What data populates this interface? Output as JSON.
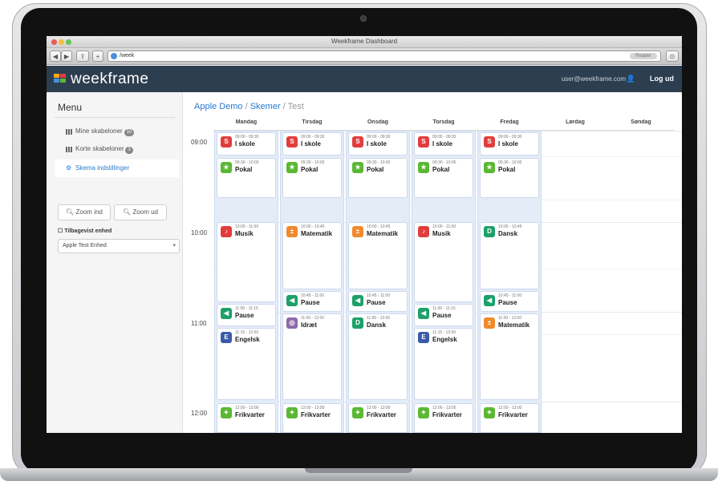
{
  "browser": {
    "window_title": "Weekframe Dashboard",
    "address": "/week",
    "reader_label": "Reader",
    "back_label": "◀",
    "forward_label": "▶",
    "share_label": "⇪",
    "add_label": "+"
  },
  "header": {
    "logo": "weekframe",
    "user_email": "user@weekframe.com",
    "logout": "Log ud",
    "colors": {
      "bar": "#2d3e50",
      "logo_a": "#f5a623",
      "logo_b": "#4a90d9"
    }
  },
  "sidebar": {
    "title": "Menu",
    "items": [
      {
        "label": "Mine skabeloner",
        "badge": "10",
        "icon": "grid-icon"
      },
      {
        "label": "Korte skabeloner",
        "badge": "3",
        "icon": "grid-icon"
      },
      {
        "label": "Skema indstillinger",
        "badge": "",
        "icon": "settings-icon"
      }
    ],
    "zoom_in": "Zoom ind",
    "zoom_out": "Zoom ud",
    "hide_label": "Tilbagevist enhed",
    "select_value": "Apple Test Enhed"
  },
  "breadcrumb": {
    "part1": "Apple Demo",
    "sep1": " / ",
    "part2": "Skemer",
    "sep2": " / ",
    "current": "Test"
  },
  "calendar": {
    "days": [
      "Mandag",
      "Tirsdag",
      "Onsdag",
      "Torsdag",
      "Fredag",
      "Lørdag",
      "Søndag"
    ],
    "hours": [
      "09:00",
      "10:00",
      "11:00",
      "12:00"
    ],
    "events": {
      "mon": [
        {
          "time": "09:00 - 09:30",
          "title": "I skole",
          "color": "#e23d3d",
          "icon": "S"
        },
        {
          "time": "09:30 - 10:00",
          "title": "Pokal",
          "color": "#5bb834",
          "icon": "★"
        },
        {
          "time": "10:00 - 11:00",
          "title": "Musik",
          "color": "#e23d3d",
          "icon": "♪"
        },
        {
          "time": "11:00 - 11:15",
          "title": "Pause",
          "color": "#1da06a",
          "icon": "◀"
        },
        {
          "time": "11:15 - 12:00",
          "title": "Engelsk",
          "color": "#3b5ba9",
          "icon": "E"
        },
        {
          "time": "12:00 - 13:00",
          "title": "Frikvarter",
          "color": "#5bb834",
          "icon": "✦"
        }
      ],
      "tue": [
        {
          "time": "09:00 - 09:30",
          "title": "I skole",
          "color": "#e23d3d",
          "icon": "S"
        },
        {
          "time": "09:30 - 10:00",
          "title": "Pokal",
          "color": "#5bb834",
          "icon": "★"
        },
        {
          "time": "10:00 - 10:45",
          "title": "Matematik",
          "color": "#f08a2c",
          "icon": "±"
        },
        {
          "time": "10:45 - 11:00",
          "title": "Pause",
          "color": "#1da06a",
          "icon": "◀"
        },
        {
          "time": "11:00 - 12:00",
          "title": "Idræt",
          "color": "#8e6aa8",
          "icon": "◎"
        },
        {
          "time": "12:00 - 13:00",
          "title": "Frikvarter",
          "color": "#5bb834",
          "icon": "✦"
        }
      ],
      "wed": [
        {
          "time": "09:00 - 09:30",
          "title": "I skole",
          "color": "#e23d3d",
          "icon": "S"
        },
        {
          "time": "09:30 - 10:00",
          "title": "Pokal",
          "color": "#5bb834",
          "icon": "★"
        },
        {
          "time": "10:00 - 10:45",
          "title": "Matematik",
          "color": "#f08a2c",
          "icon": "±"
        },
        {
          "time": "10:45 - 11:00",
          "title": "Pause",
          "color": "#1da06a",
          "icon": "◀"
        },
        {
          "time": "11:00 - 12:00",
          "title": "Dansk",
          "color": "#1da06a",
          "icon": "D"
        },
        {
          "time": "12:00 - 13:00",
          "title": "Frikvarter",
          "color": "#5bb834",
          "icon": "✦"
        }
      ],
      "thu": [
        {
          "time": "09:00 - 09:30",
          "title": "I skole",
          "color": "#e23d3d",
          "icon": "S"
        },
        {
          "time": "09:30 - 10:00",
          "title": "Pokal",
          "color": "#5bb834",
          "icon": "★"
        },
        {
          "time": "10:00 - 11:00",
          "title": "Musik",
          "color": "#e23d3d",
          "icon": "♪"
        },
        {
          "time": "11:00 - 11:15",
          "title": "Pause",
          "color": "#1da06a",
          "icon": "◀"
        },
        {
          "time": "11:15 - 12:00",
          "title": "Engelsk",
          "color": "#3b5ba9",
          "icon": "E"
        },
        {
          "time": "12:00 - 13:00",
          "title": "Frikvarter",
          "color": "#5bb834",
          "icon": "✦"
        }
      ],
      "fri": [
        {
          "time": "09:00 - 09:30",
          "title": "I skole",
          "color": "#e23d3d",
          "icon": "S"
        },
        {
          "time": "09:30 - 10:00",
          "title": "Pokal",
          "color": "#5bb834",
          "icon": "★"
        },
        {
          "time": "10:00 - 10:45",
          "title": "Dansk",
          "color": "#1da06a",
          "icon": "D"
        },
        {
          "time": "10:45 - 11:00",
          "title": "Pause",
          "color": "#1da06a",
          "icon": "◀"
        },
        {
          "time": "11:00 - 12:00",
          "title": "Matematik",
          "color": "#f08a2c",
          "icon": "±"
        },
        {
          "time": "12:00 - 13:00",
          "title": "Frikvarter",
          "color": "#5bb834",
          "icon": "✦"
        }
      ]
    }
  }
}
